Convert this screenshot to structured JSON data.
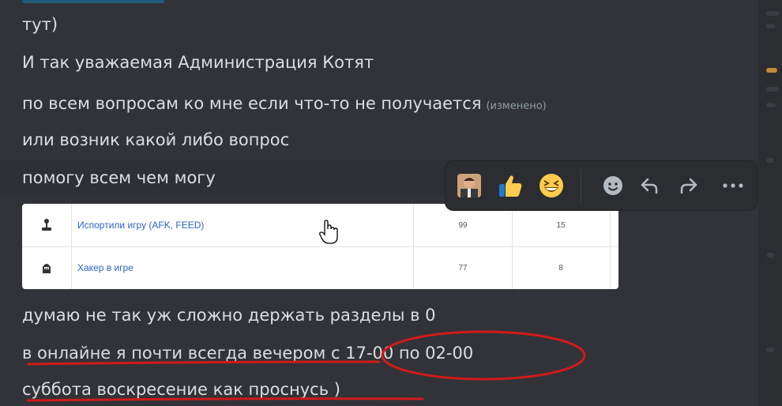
{
  "messages": [
    {
      "text": "тут)"
    },
    {
      "text": "И так уважаемая Администрация Котят"
    },
    {
      "text": "по всем вопросам ко мне если что-то не получается",
      "edited": "(изменено)"
    },
    {
      "text": "или возник какой либо вопрос"
    },
    {
      "text": "помогу всем чем могу"
    },
    {
      "text": "думаю не так уж сложно держать разделы в 0"
    },
    {
      "text": "в онлайне я почти всегда вечером с 17-00 по 02-00"
    },
    {
      "text": "суббота воскресение как проснусь )"
    }
  ],
  "embed": {
    "rows": [
      {
        "icon": "joystick-icon",
        "label": "Испортили игру (AFK, FEED)",
        "v1": "99",
        "v2": "15"
      },
      {
        "icon": "hacker-icon",
        "label": "Хакер в игре",
        "v1": "77",
        "v2": "8"
      }
    ]
  },
  "toolbar": {
    "reactions": [
      "man-emoji",
      "thumbs-up-emoji",
      "laughing-emoji"
    ],
    "actions": [
      "add-reaction-icon",
      "reply-icon",
      "forward-icon",
      "more-icon"
    ]
  },
  "colors": {
    "background": "#313338",
    "text": "#dbdee1",
    "muted": "#949ba4",
    "annotation": "#d11a1a",
    "link": "#2a64c5"
  }
}
